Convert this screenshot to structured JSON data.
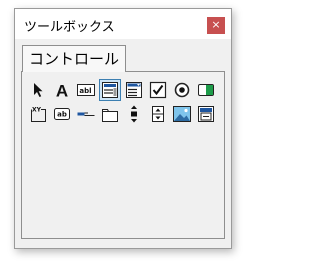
{
  "window": {
    "title": "ツールボックス",
    "close_glyph": "×"
  },
  "tabs": [
    {
      "label": "コントロール",
      "active": true
    }
  ],
  "toolbox": {
    "selected_tool": "listbox",
    "row1": [
      "select-objects",
      "label",
      "textbox",
      "listbox",
      "combobox",
      "checkbox",
      "option-button",
      "toggle-button"
    ],
    "row2": [
      "frame",
      "command-button",
      "tabstrip",
      "multipage",
      "scrollbar",
      "spinbutton",
      "image",
      "refedit"
    ],
    "icon_labels": {
      "label": "A",
      "textbox": "abl",
      "command-button": "ab",
      "frame": "XY"
    }
  },
  "colors": {
    "close_button": "#c75050",
    "selected_bg": "#cce4f7",
    "selected_border": "#3c7fb1",
    "toggle_green": "#1e9c4a"
  }
}
